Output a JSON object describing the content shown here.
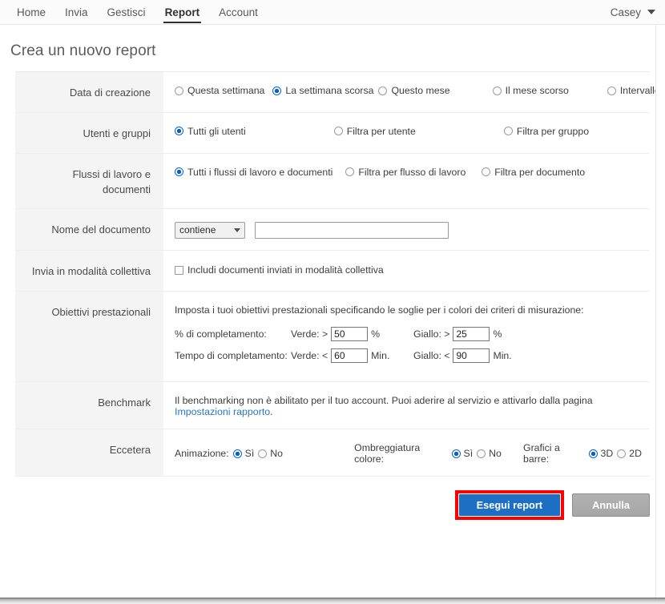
{
  "nav": {
    "items": [
      {
        "label": "Home",
        "active": false
      },
      {
        "label": "Invia",
        "active": false
      },
      {
        "label": "Gestisci",
        "active": false
      },
      {
        "label": "Report",
        "active": true
      },
      {
        "label": "Account",
        "active": false
      }
    ],
    "user": "Casey"
  },
  "page": {
    "title": "Crea un nuovo report"
  },
  "rows": {
    "creation_date": {
      "label": "Data di creazione",
      "options": [
        {
          "label": "Questa settimana",
          "selected": false
        },
        {
          "label": "La settimana scorsa",
          "selected": true
        },
        {
          "label": "Questo mese",
          "selected": false
        },
        {
          "label": "Il mese scorso",
          "selected": false
        },
        {
          "label": "Intervallo date",
          "selected": false
        }
      ]
    },
    "users_groups": {
      "label": "Utenti e gruppi",
      "options": [
        {
          "label": "Tutti gli utenti",
          "selected": true
        },
        {
          "label": "Filtra per utente",
          "selected": false
        },
        {
          "label": "Filtra per gruppo",
          "selected": false
        }
      ]
    },
    "workflows_documents": {
      "label": "Flussi di lavoro e documenti",
      "options": [
        {
          "label": "Tutti i flussi di lavoro e documenti",
          "selected": true
        },
        {
          "label": "Filtra per flusso di lavoro",
          "selected": false
        },
        {
          "label": "Filtra per documento",
          "selected": false
        }
      ]
    },
    "document_name": {
      "label": "Nome del documento",
      "operator_value": "contiene",
      "operator_options": [
        "contiene"
      ],
      "text_value": "",
      "text_placeholder": ""
    },
    "bulk_send": {
      "label": "Invia in modalità collettiva",
      "checkbox_label": "Includi documenti inviati in modalità collettiva",
      "checked": false
    },
    "performance_goals": {
      "label": "Obiettivi prestazionali",
      "intro": "Imposta i tuoi obiettivi prestazionali specificando le soglie per i colori dei criteri di misurazione:",
      "goals": [
        {
          "name": "% di completamento:",
          "green_label": "Verde: >",
          "green_value": "50",
          "green_unit": "%",
          "yellow_label": "Giallo: >",
          "yellow_value": "25",
          "yellow_unit": "%"
        },
        {
          "name": "Tempo di completamento:",
          "green_label": "Verde: <",
          "green_value": "60",
          "green_unit": "Min.",
          "yellow_label": "Giallo: <",
          "yellow_value": "90",
          "yellow_unit": "Min."
        }
      ]
    },
    "benchmark": {
      "label": "Benchmark",
      "text_before": "Il benchmarking non è abilitato per il tuo account. Puoi aderire al servizio e attivarlo dalla pagina ",
      "link_text": "Impostazioni rapporto",
      "text_after": "."
    },
    "etcetera": {
      "label": "Eccetera",
      "groups": [
        {
          "title": "Animazione:",
          "options": [
            {
              "label": "Sì",
              "selected": true
            },
            {
              "label": "No",
              "selected": false
            }
          ]
        },
        {
          "title": "Ombreggiatura colore:",
          "options": [
            {
              "label": "Sì",
              "selected": true
            },
            {
              "label": "No",
              "selected": false
            }
          ]
        },
        {
          "title": "Grafici a barre:",
          "options": [
            {
              "label": "3D",
              "selected": true
            },
            {
              "label": "2D",
              "selected": false
            }
          ]
        }
      ]
    }
  },
  "actions": {
    "primary_label": "Esegui report",
    "secondary_label": "Annulla",
    "highlight_color": "#ff0000",
    "primary_color": "#1d6fc4"
  }
}
